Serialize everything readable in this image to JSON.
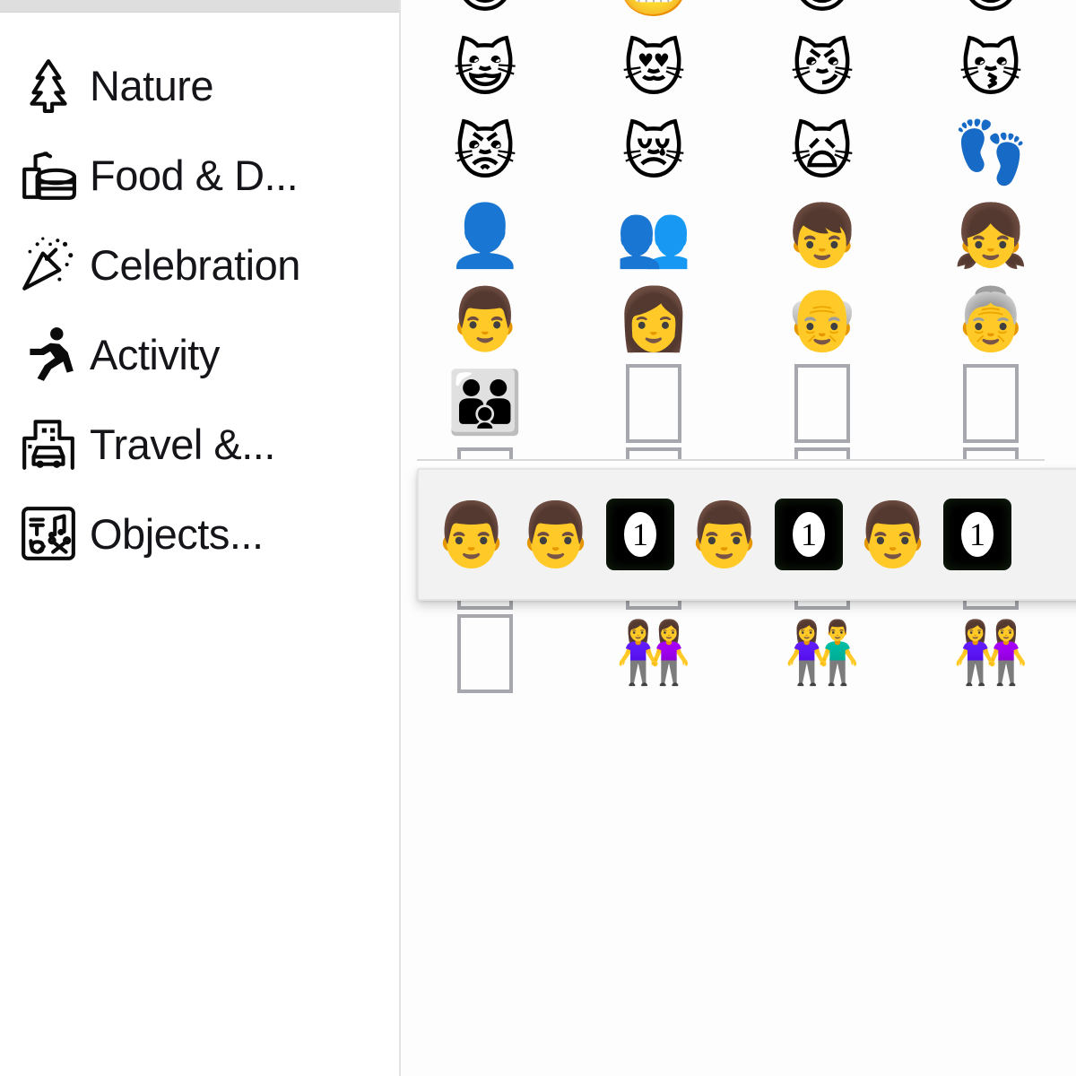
{
  "app": {
    "name": "emoji-picker",
    "accent_color": "#141419",
    "sidebar_divider_color": "#e2e2e2",
    "popup_background": "#f2f2f2",
    "tofu_border_color": "#a6a8ad"
  },
  "sidebar": {
    "items": [
      {
        "label": "Nature",
        "icon": "evergreen-tree-icon"
      },
      {
        "label": "Food & D...",
        "icon": "food-drink-icon"
      },
      {
        "label": "Celebration",
        "icon": "party-popper-icon"
      },
      {
        "label": "Activity",
        "icon": "running-person-icon"
      },
      {
        "label": "Travel &...",
        "icon": "car-building-icon"
      },
      {
        "label": "Objects...",
        "icon": "symbols-grid-icon"
      }
    ]
  },
  "emoji_grid": {
    "columns": 4,
    "rows": [
      [
        {
          "glyph": "😃",
          "name": "smiling-face-open-mouth"
        },
        {
          "glyph": "😬",
          "name": "grimacing-face"
        },
        {
          "glyph": "😁",
          "name": "beaming-face"
        },
        {
          "glyph": "😂",
          "name": "face-with-tears-of-joy"
        }
      ],
      [
        {
          "glyph": "😺",
          "name": "grinning-cat-face"
        },
        {
          "glyph": "😻",
          "name": "smiling-cat-heart-eyes"
        },
        {
          "glyph": "😼",
          "name": "cat-face-wry-smile"
        },
        {
          "glyph": "😽",
          "name": "kissing-cat-face"
        }
      ],
      [
        {
          "glyph": "😾",
          "name": "pouting-cat-face"
        },
        {
          "glyph": "😿",
          "name": "crying-cat-face"
        },
        {
          "glyph": "🙀",
          "name": "weary-cat-face"
        },
        {
          "glyph": "👣",
          "name": "footprints"
        }
      ],
      [
        {
          "glyph": "👤",
          "name": "bust-in-silhouette"
        },
        {
          "glyph": "👥",
          "name": "busts-in-silhouette"
        },
        {
          "glyph": "👦",
          "name": "boy"
        },
        {
          "glyph": "👧",
          "name": "girl"
        }
      ],
      [
        {
          "glyph": "👨",
          "name": "man"
        },
        {
          "glyph": "👩",
          "name": "woman"
        },
        {
          "glyph": "👴",
          "name": "older-man"
        },
        {
          "glyph": "👵",
          "name": "older-woman"
        }
      ],
      [
        {
          "glyph": "👪",
          "name": "family"
        },
        {
          "glyph": "",
          "name": "missing-glyph-box"
        },
        {
          "glyph": "",
          "name": "missing-glyph-box"
        },
        {
          "glyph": "",
          "name": "missing-glyph-box"
        }
      ],
      [
        {
          "glyph": "",
          "name": "missing-glyph-box"
        },
        {
          "glyph": "",
          "name": "missing-glyph-box"
        },
        {
          "glyph": "",
          "name": "missing-glyph-box"
        },
        {
          "glyph": "",
          "name": "missing-glyph-box"
        }
      ],
      [
        {
          "glyph": "",
          "name": "missing-glyph-box"
        },
        {
          "glyph": "",
          "name": "missing-glyph-box"
        },
        {
          "glyph": "",
          "name": "missing-glyph-box"
        },
        {
          "glyph": "",
          "name": "missing-glyph-box"
        }
      ],
      [
        {
          "glyph": "",
          "name": "missing-glyph-box"
        },
        {
          "glyph": "👭",
          "name": "two-women-holding-hands"
        },
        {
          "glyph": "👫",
          "name": "man-and-woman-holding-hands"
        },
        {
          "glyph": "👭",
          "name": "two-women-holding-hands"
        }
      ]
    ]
  },
  "skin_tone_popup": {
    "visible": true,
    "items": [
      {
        "type": "emoji",
        "glyph": "👨",
        "name": "man-default-tone"
      },
      {
        "type": "emoji",
        "glyph": "👨",
        "name": "man-light-tone"
      },
      {
        "type": "modifier-box",
        "digit": "1",
        "name": "skin-tone-modifier-box"
      },
      {
        "type": "emoji",
        "glyph": "👨",
        "name": "man-medium-light-tone"
      },
      {
        "type": "modifier-box",
        "digit": "1",
        "name": "skin-tone-modifier-box"
      },
      {
        "type": "emoji",
        "glyph": "👨",
        "name": "man-medium-tone"
      },
      {
        "type": "modifier-box",
        "digit": "1",
        "name": "skin-tone-modifier-box"
      }
    ]
  }
}
